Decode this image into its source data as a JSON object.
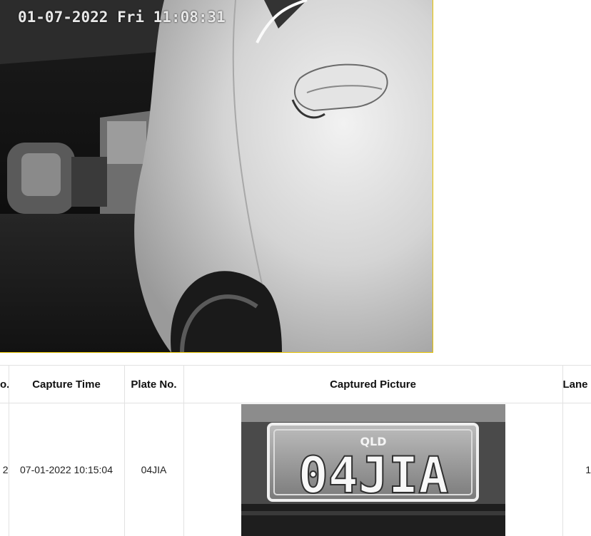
{
  "live_view": {
    "osd_timestamp": "01-07-2022 Fri 11:08:31"
  },
  "table": {
    "headers": {
      "no": "o.",
      "capture_time": "Capture Time",
      "plate_no": "Plate No.",
      "captured_picture": "Captured Picture",
      "lane": "Lane"
    },
    "rows": [
      {
        "no": "2",
        "capture_time": "07-01-2022 10:15:04",
        "plate_no": "04JIA",
        "plate_image_text": "04JIA",
        "plate_image_state": "QLD",
        "lane": "1"
      }
    ]
  }
}
